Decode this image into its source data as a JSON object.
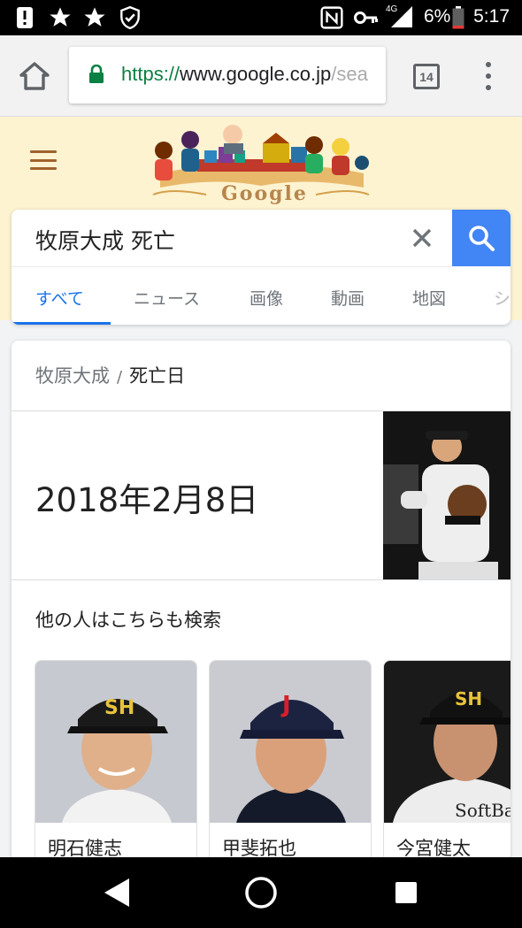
{
  "status_bar": {
    "battery_percent": "6%",
    "network": "4G",
    "time": "5:17"
  },
  "browser": {
    "url_scheme": "https://",
    "url_host": "www.google.co.jp",
    "url_rest": "/sea",
    "tab_count": "14"
  },
  "google": {
    "doodle_word": "Google"
  },
  "search": {
    "query": "牧原大成 死亡",
    "tabs": [
      "すべて",
      "ニュース",
      "画像",
      "動画",
      "地図",
      "シ"
    ],
    "active_tab": 0
  },
  "result": {
    "breadcrumb_entity": "牧原大成",
    "breadcrumb_sep": "/",
    "breadcrumb_attr": "死亡日",
    "answer": "2018年2月8日",
    "also_search_title": "他の人はこちらも検索",
    "people": [
      {
        "name": "明石健志"
      },
      {
        "name": "甲斐拓也"
      },
      {
        "name": "今宮健太"
      }
    ]
  },
  "colors": {
    "accent_blue": "#4285f4",
    "tab_active": "#1a73e8",
    "doodle_bg": "#fdf3d1",
    "url_green": "#0b8043"
  }
}
